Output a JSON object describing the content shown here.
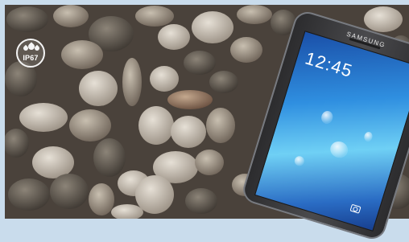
{
  "badge": {
    "label": "IP67"
  },
  "phone": {
    "brand": "SAMSUNG",
    "clock": "12:45"
  },
  "icons": {
    "badge": "water-resistance-badge",
    "camera": "camera-icon"
  }
}
